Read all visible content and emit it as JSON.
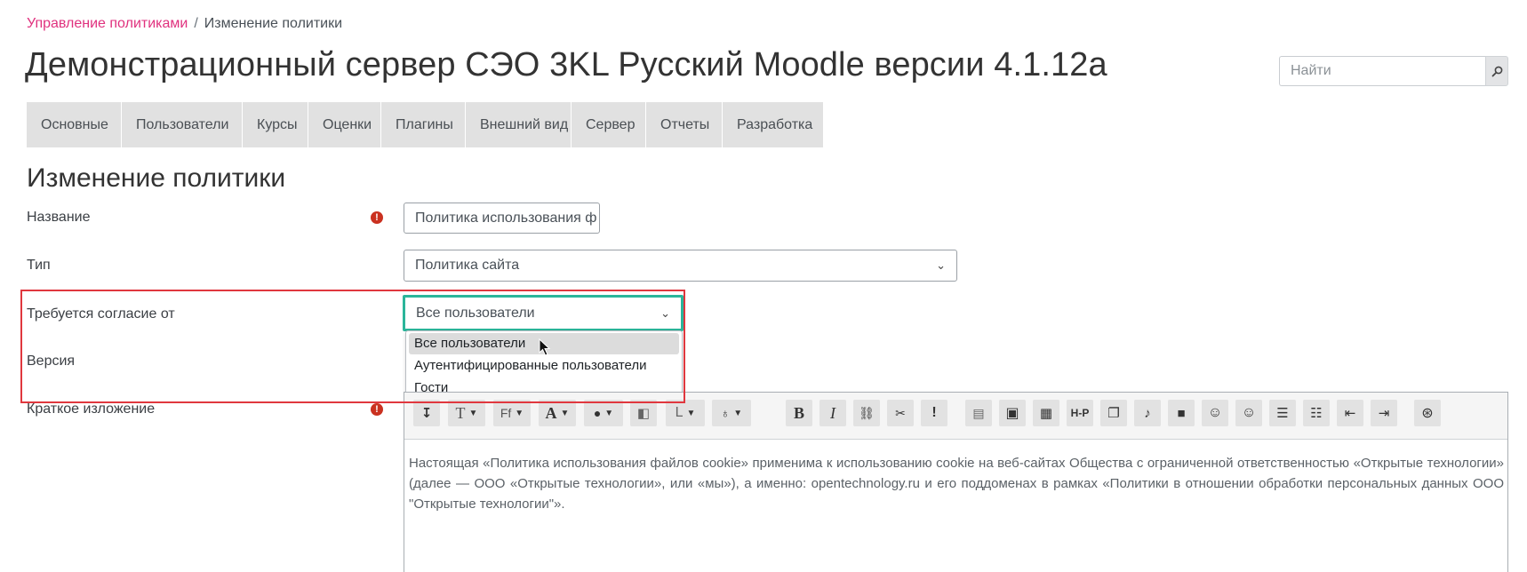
{
  "breadcrumb": {
    "link": "Управление политиками",
    "separator": "/",
    "current": "Изменение политики"
  },
  "header": {
    "title": "Демонстрационный сервер СЭО 3KL Русский Moodle версии 4.1.12a",
    "search_placeholder": "Найти",
    "search_icon": "search-icon"
  },
  "nav": {
    "tabs": [
      "Основные",
      "Пользователи",
      "Курсы",
      "Оценки",
      "Плагины",
      "Внешний вид",
      "Сервер",
      "Отчеты",
      "Разработка"
    ]
  },
  "section_title": "Изменение политики",
  "form": {
    "name_label": "Название",
    "name_value": "Политика использования ф",
    "type_label": "Тип",
    "type_value": "Политика сайта",
    "consent_label": "Требуется согласие от",
    "consent_value": "Все пользователи",
    "consent_options": [
      "Все пользователи",
      "Аутентифицированные пользователи",
      "Гости"
    ],
    "version_label": "Версия",
    "summary_label": "Краткое изложение",
    "summary_text": "Настоящая «Политика использования файлов cookie» применима к использованию cookie на веб-сайтах Общества с ограниченной ответственностью «Открытые технологии» (далее — ООО «Открытые технологии», или «мы»), а именно: opentechnology.ru и его поддоменах в рамках «Политики в отношении обработки персональных данных ООО \"Открытые технологии\"»."
  },
  "toolbar": {
    "b_label": "B",
    "i_label": "I",
    "exclaim_label": "!",
    "h5p_label": "H-P",
    "ff_label": "Ff"
  },
  "colors": {
    "accent_link": "#e0317e",
    "focus_border": "#2bb59a",
    "highlight_border": "#e0373e",
    "required_icon": "#ca3120"
  }
}
